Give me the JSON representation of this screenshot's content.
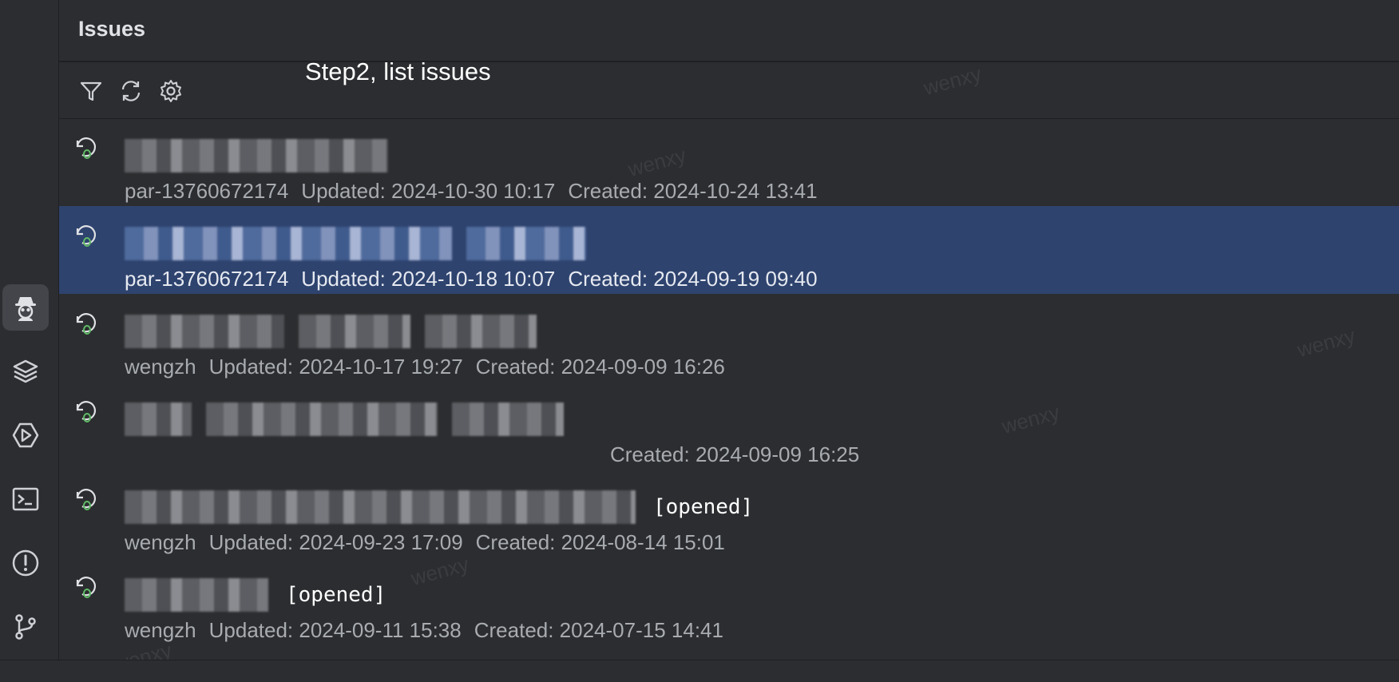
{
  "panel": {
    "title": "Issues",
    "caption": "Step2, list issues"
  },
  "toolbar": {
    "filter_icon": "filter-icon",
    "refresh_icon": "refresh-icon",
    "settings_icon": "gear-icon"
  },
  "activity_bar": [
    {
      "icon": "spy-agent-icon",
      "active": true
    },
    {
      "icon": "layers-icon",
      "active": false
    },
    {
      "icon": "run-hexagon-icon",
      "active": false
    },
    {
      "icon": "terminal-icon",
      "active": false
    },
    {
      "icon": "problems-icon",
      "active": false
    },
    {
      "icon": "git-branch-icon",
      "active": false
    }
  ],
  "issues": [
    {
      "author": "par-13760672174",
      "updated": "Updated: 2024-10-30 10:17",
      "created": "Created: 2024-10-24 13:41",
      "state": "",
      "selected": false
    },
    {
      "author": "par-13760672174",
      "updated": "Updated: 2024-10-18 10:07",
      "created": "Created: 2024-09-19 09:40",
      "state": "",
      "selected": true
    },
    {
      "author": "wengzh",
      "updated": "Updated: 2024-10-17 19:27",
      "created": "Created: 2024-09-09 16:26",
      "state": "",
      "selected": false
    },
    {
      "author": "",
      "updated": "",
      "created": "Created: 2024-09-09 16:25",
      "state": "",
      "selected": false
    },
    {
      "author": "wengzh",
      "updated": "Updated: 2024-09-23 17:09",
      "created": "Created: 2024-08-14 15:01",
      "state": "[opened]",
      "selected": false
    },
    {
      "author": "wengzh",
      "updated": "Updated: 2024-09-11 15:38",
      "created": "Created: 2024-07-15 14:41",
      "state": "[opened]",
      "selected": false
    }
  ],
  "watermark": "wenxy",
  "colors": {
    "background": "#2b2d30",
    "selection": "#2e436e",
    "issue_icon_green": "#5fb865"
  }
}
